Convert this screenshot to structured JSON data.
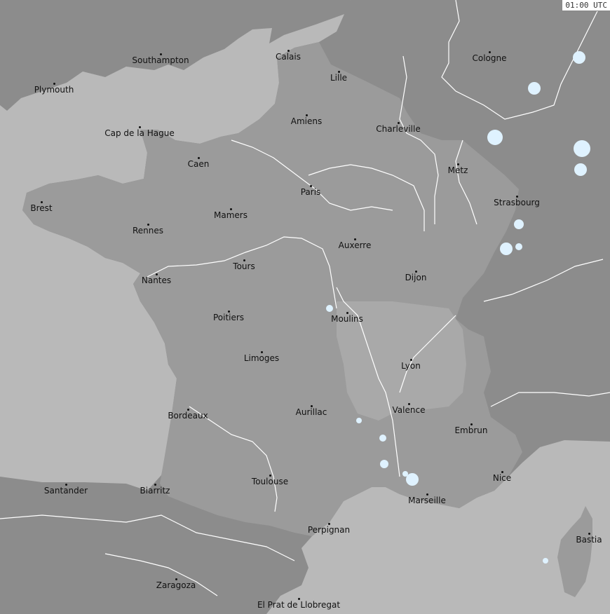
{
  "timestamp": "01:00 UTC",
  "colors": {
    "sea": "#b9b9b9",
    "land_foreign": "#8c8c8c",
    "land_france": "#9b9b9b",
    "land_light": "#a9a9a9",
    "rivers": "#ffffff",
    "lightning": "#dff2ff"
  },
  "cities": [
    {
      "name": "Southampton"
    },
    {
      "name": "Plymouth"
    },
    {
      "name": "Calais"
    },
    {
      "name": "Lille"
    },
    {
      "name": "Cologne"
    },
    {
      "name": "Amiens"
    },
    {
      "name": "Charleville"
    },
    {
      "name": "Cap de la Hague"
    },
    {
      "name": "Caen"
    },
    {
      "name": "Metz"
    },
    {
      "name": "Paris"
    },
    {
      "name": "Brest"
    },
    {
      "name": "Strasbourg"
    },
    {
      "name": "Mamers"
    },
    {
      "name": "Rennes"
    },
    {
      "name": "Auxerre"
    },
    {
      "name": "Tours"
    },
    {
      "name": "Dijon"
    },
    {
      "name": "Nantes"
    },
    {
      "name": "Poitiers"
    },
    {
      "name": "Moulins"
    },
    {
      "name": "Limoges"
    },
    {
      "name": "Lyon"
    },
    {
      "name": "Valence"
    },
    {
      "name": "Aurillac"
    },
    {
      "name": "Bordeaux"
    },
    {
      "name": "Embrun"
    },
    {
      "name": "Nice"
    },
    {
      "name": "Toulouse"
    },
    {
      "name": "Santander"
    },
    {
      "name": "Biarritz"
    },
    {
      "name": "Marseille"
    },
    {
      "name": "Perpignan"
    },
    {
      "name": "Bastia"
    },
    {
      "name": "Zaragoza"
    },
    {
      "name": "El Prat de Llobregat"
    }
  ]
}
